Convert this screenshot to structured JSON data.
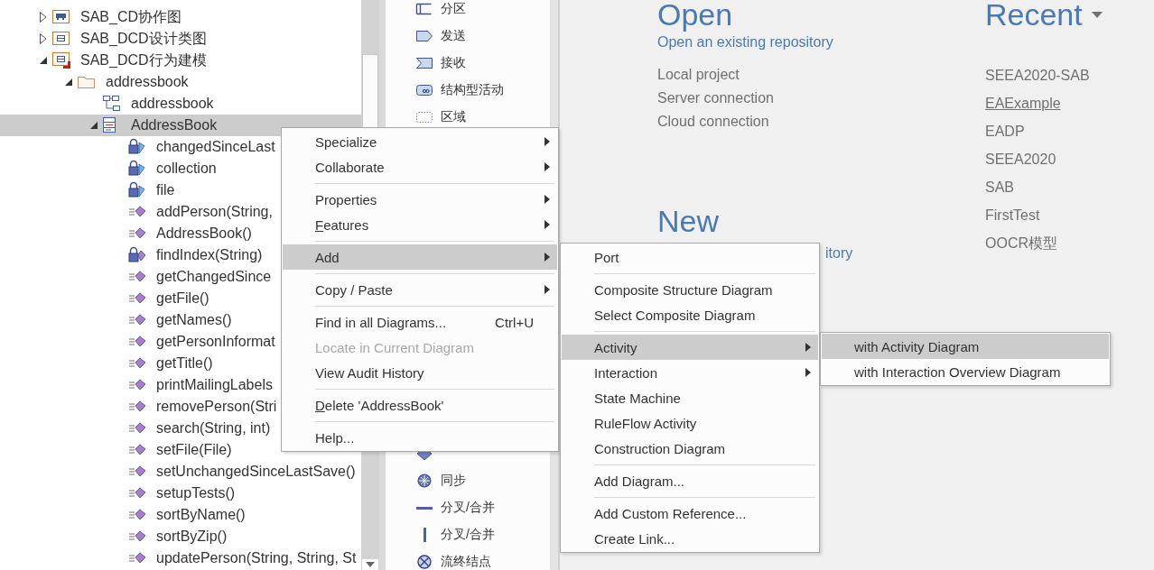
{
  "tree": [
    {
      "label": "SAB_CD协作图",
      "kind": "collab-package",
      "expanded": false,
      "selected": false
    },
    {
      "label": "SAB_DCD设计类图",
      "kind": "class-package",
      "expanded": false,
      "selected": false
    },
    {
      "label": "SAB_DCD行为建模",
      "kind": "behavior-package",
      "expanded": true,
      "selected": false,
      "children": [
        {
          "label": "addressbook",
          "kind": "folder",
          "expanded": true,
          "selected": false,
          "children": [
            {
              "label": "addressbook",
              "kind": "diagram",
              "selected": false
            },
            {
              "label": "AddressBook",
              "kind": "class",
              "expanded": true,
              "selected": true,
              "children": [
                {
                  "label": "changedSinceLast",
                  "kind": "attribute",
                  "selected": false
                },
                {
                  "label": "collection",
                  "kind": "attribute",
                  "selected": false
                },
                {
                  "label": "file",
                  "kind": "attribute",
                  "selected": false
                },
                {
                  "label": "addPerson(String,",
                  "kind": "operation",
                  "selected": false
                },
                {
                  "label": "AddressBook()",
                  "kind": "operation",
                  "selected": false
                },
                {
                  "label": "findIndex(String)",
                  "kind": "private-operation",
                  "selected": false
                },
                {
                  "label": "getChangedSince",
                  "kind": "operation",
                  "selected": false
                },
                {
                  "label": "getFile()",
                  "kind": "operation",
                  "selected": false
                },
                {
                  "label": "getNames()",
                  "kind": "operation",
                  "selected": false
                },
                {
                  "label": "getPersonInformat",
                  "kind": "operation",
                  "selected": false
                },
                {
                  "label": "getTitle()",
                  "kind": "operation",
                  "selected": false
                },
                {
                  "label": "printMailingLabels",
                  "kind": "operation",
                  "selected": false
                },
                {
                  "label": "removePerson(Stri",
                  "kind": "operation",
                  "selected": false
                },
                {
                  "label": "search(String, int)",
                  "kind": "operation",
                  "selected": false
                },
                {
                  "label": "setFile(File)",
                  "kind": "operation",
                  "selected": false
                },
                {
                  "label": "setUnchangedSinceLastSave()",
                  "kind": "operation",
                  "selected": false
                },
                {
                  "label": "setupTests()",
                  "kind": "operation",
                  "selected": false
                },
                {
                  "label": "sortByName()",
                  "kind": "operation",
                  "selected": false
                },
                {
                  "label": "sortByZip()",
                  "kind": "operation",
                  "selected": false
                },
                {
                  "label": "updatePerson(String, String, St",
                  "kind": "operation",
                  "selected": false
                }
              ]
            }
          ]
        }
      ]
    }
  ],
  "toolbox": {
    "sections": [
      {
        "items": [
          {
            "label": "分区",
            "kind": "partition"
          },
          {
            "label": "发送",
            "kind": "send"
          },
          {
            "label": "接收",
            "kind": "receive"
          },
          {
            "label": "结构型活动",
            "kind": "structured"
          },
          {
            "label": "区域",
            "kind": "region"
          }
        ]
      },
      {
        "items": [
          {
            "kind": "merge"
          },
          {
            "label": "同步",
            "kind": "sync"
          },
          {
            "label": "分叉/合并",
            "kind": "fork-horizontal"
          },
          {
            "label": "分叉/合并",
            "kind": "fork-vertical"
          },
          {
            "label": "流终结点",
            "kind": "flow-final"
          }
        ]
      }
    ]
  },
  "start_page": {
    "open": {
      "heading": "Open",
      "link": "Open an existing repository",
      "options": [
        "Local project",
        "Server connection",
        "Cloud connection"
      ]
    },
    "new": {
      "heading": "New",
      "link": "itory"
    },
    "recent": {
      "heading": "Recent",
      "items": [
        {
          "label": "SEEA2020-SAB",
          "hovered": false
        },
        {
          "label": "EAExample",
          "hovered": true
        },
        {
          "label": "EADP",
          "hovered": false
        },
        {
          "label": "SEEA2020",
          "hovered": false
        },
        {
          "label": "SAB",
          "hovered": false
        },
        {
          "label": "FirstTest",
          "hovered": false
        },
        {
          "label": "OOCR模型",
          "hovered": false
        }
      ]
    }
  },
  "context_menu": {
    "items": [
      {
        "kind": "item",
        "label": "Specialize",
        "submenu": true,
        "selected": false,
        "disabled": false,
        "underline_first": false
      },
      {
        "kind": "item",
        "label": "Collaborate",
        "submenu": true,
        "selected": false,
        "disabled": false,
        "underline_first": false
      },
      {
        "kind": "separator"
      },
      {
        "kind": "item",
        "label": "Properties",
        "submenu": true,
        "selected": false,
        "disabled": false,
        "underline_first": false
      },
      {
        "kind": "item",
        "label": "Features",
        "submenu": true,
        "selected": false,
        "disabled": false,
        "underline_first": true
      },
      {
        "kind": "separator"
      },
      {
        "kind": "item",
        "label": "Add",
        "submenu": true,
        "selected": true,
        "disabled": false,
        "underline_first": false,
        "items": [
          {
            "kind": "item",
            "label": "Port",
            "submenu": false,
            "selected": false,
            "disabled": false,
            "underline_first": false
          },
          {
            "kind": "separator"
          },
          {
            "kind": "item",
            "label": "Composite Structure Diagram",
            "submenu": false,
            "selected": false,
            "disabled": false,
            "underline_first": false
          },
          {
            "kind": "item",
            "label": "Select Composite Diagram",
            "submenu": false,
            "selected": false,
            "disabled": false,
            "underline_first": false
          },
          {
            "kind": "separator"
          },
          {
            "kind": "item",
            "label": "Activity",
            "submenu": true,
            "selected": true,
            "disabled": false,
            "underline_first": false,
            "items": [
              {
                "kind": "item",
                "label": "with Activity Diagram",
                "submenu": false,
                "selected": true,
                "disabled": false,
                "underline_first": false
              },
              {
                "kind": "item",
                "label": "with Interaction Overview Diagram",
                "submenu": false,
                "selected": false,
                "disabled": false,
                "underline_first": false
              }
            ]
          },
          {
            "kind": "item",
            "label": "Interaction",
            "submenu": true,
            "selected": false,
            "disabled": false,
            "underline_first": false
          },
          {
            "kind": "item",
            "label": "State Machine",
            "submenu": false,
            "selected": false,
            "disabled": false,
            "underline_first": false
          },
          {
            "kind": "item",
            "label": "RuleFlow Activity",
            "submenu": false,
            "selected": false,
            "disabled": false,
            "underline_first": false
          },
          {
            "kind": "item",
            "label": "Construction Diagram",
            "submenu": false,
            "selected": false,
            "disabled": false,
            "underline_first": false
          },
          {
            "kind": "separator"
          },
          {
            "kind": "item",
            "label": "Add Diagram...",
            "submenu": false,
            "selected": false,
            "disabled": false,
            "underline_first": false
          },
          {
            "kind": "separator"
          },
          {
            "kind": "item",
            "label": "Add Custom Reference...",
            "submenu": false,
            "selected": false,
            "disabled": false,
            "underline_first": false
          },
          {
            "kind": "item",
            "label": "Create Link...",
            "submenu": false,
            "selected": false,
            "disabled": false,
            "underline_first": false
          }
        ]
      },
      {
        "kind": "separator"
      },
      {
        "kind": "item",
        "label": "Copy / Paste",
        "submenu": true,
        "selected": false,
        "disabled": false,
        "underline_first": false
      },
      {
        "kind": "separator"
      },
      {
        "kind": "item",
        "label": "Find in all Diagrams...",
        "shortcut": "Ctrl+U",
        "submenu": false,
        "selected": false,
        "disabled": false,
        "underline_first": false
      },
      {
        "kind": "item",
        "label": "Locate in Current Diagram",
        "submenu": false,
        "selected": false,
        "disabled": true,
        "underline_first": false
      },
      {
        "kind": "item",
        "label": "View Audit History",
        "submenu": false,
        "selected": false,
        "disabled": false,
        "underline_first": false
      },
      {
        "kind": "separator"
      },
      {
        "kind": "item",
        "label": "Delete 'AddressBook'",
        "submenu": false,
        "selected": false,
        "disabled": false,
        "underline_first": true
      },
      {
        "kind": "separator"
      },
      {
        "kind": "item",
        "label": "Help...",
        "submenu": false,
        "selected": false,
        "disabled": false,
        "underline_first": false
      }
    ]
  }
}
